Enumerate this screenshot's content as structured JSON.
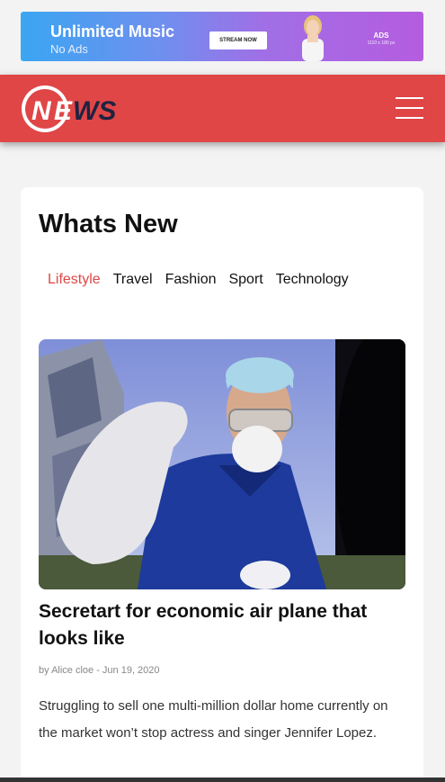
{
  "ad": {
    "title": "Unlimited Music",
    "subtitle": "No Ads",
    "button": "STREAM NOW",
    "label": "ADS",
    "size": "1110 x 180 px"
  },
  "header": {
    "logo_text": "NEWS",
    "menu_icon": "hamburger-icon"
  },
  "section": {
    "title": "Whats New",
    "tabs": [
      "Lifestyle",
      "Travel",
      "Fashion",
      "Sport",
      "Technology"
    ],
    "active_tab": "Lifestyle"
  },
  "article": {
    "headline": "Secretart for economic air plane that looks like",
    "meta": "by Alice cloe - Jun 19, 2020",
    "excerpt": "Struggling to sell one multi-million dollar home currently on the market won’t stop actress and singer Jennifer Lopez."
  },
  "colors": {
    "brand": "#e04646",
    "logo_dark": "#1f2240"
  }
}
